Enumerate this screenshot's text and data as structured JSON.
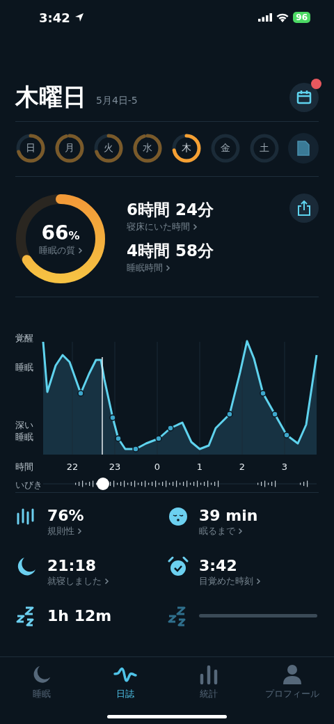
{
  "status_bar": {
    "time": "3:42",
    "battery": "96"
  },
  "header": {
    "title": "木曜日",
    "date_range": "5月4日-5",
    "calendar_notification": true
  },
  "days": [
    {
      "label": "日",
      "selected": false
    },
    {
      "label": "月",
      "selected": false
    },
    {
      "label": "火",
      "selected": false
    },
    {
      "label": "水",
      "selected": false
    },
    {
      "label": "木",
      "selected": true
    },
    {
      "label": "金",
      "selected": false
    },
    {
      "label": "土",
      "selected": false
    }
  ],
  "summary": {
    "quality": {
      "value": "66",
      "unit": "%",
      "label": "睡眠の質"
    },
    "metrics": [
      {
        "value": "6時間 24分",
        "label": "寝床にいた時間"
      },
      {
        "value": "4時間 58分",
        "label": "睡眠時間"
      }
    ]
  },
  "hypnogram": {
    "y_labels": [
      "覚醒",
      "睡眠",
      "深い睡眠"
    ],
    "x_title": "時間",
    "x_labels": [
      "22",
      "23",
      "0",
      "1",
      "2",
      "3"
    ],
    "snore_label": "いびき"
  },
  "stats": [
    {
      "kind": "bars",
      "value": "76%",
      "label": "規則性"
    },
    {
      "kind": "face",
      "value": "39 min",
      "label": "眠るまで"
    },
    {
      "kind": "moon",
      "value": "21:18",
      "label": "就寝しました"
    },
    {
      "kind": "alarm",
      "value": "3:42",
      "label": "目覚めた時刻"
    },
    {
      "kind": "zzz",
      "value": "1h 12m"
    },
    {
      "kind": "zzz"
    }
  ],
  "tabs": [
    {
      "label": "睡眠",
      "selected": false
    },
    {
      "label": "日誌",
      "selected": true
    },
    {
      "label": "統計",
      "selected": false
    },
    {
      "label": "プロフィール",
      "selected": false
    }
  ]
}
